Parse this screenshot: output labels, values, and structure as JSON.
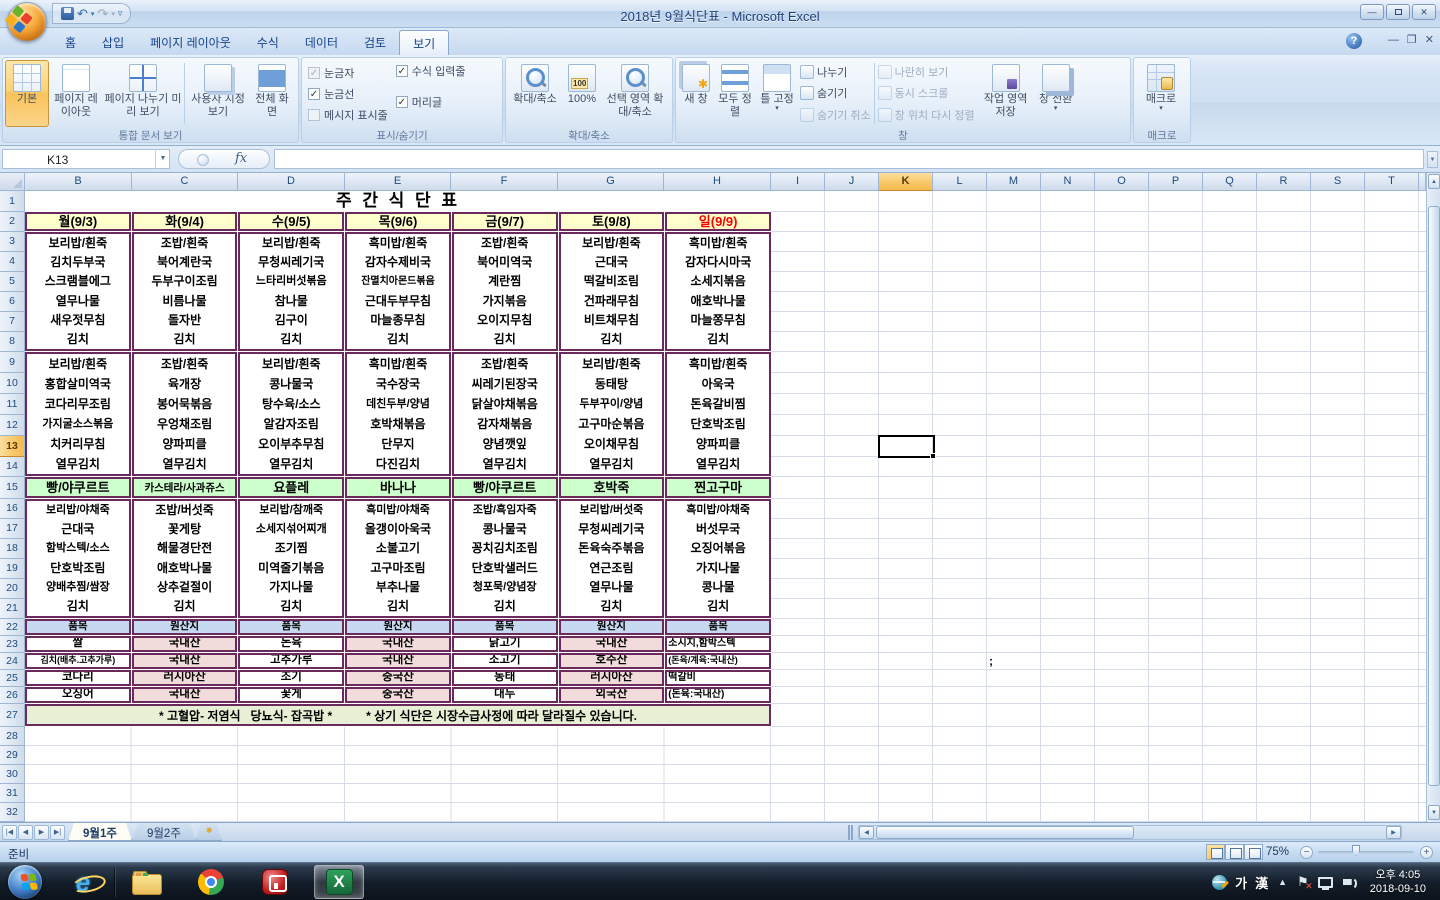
{
  "window": {
    "title": "2018년 9월식단표 - Microsoft Excel",
    "controls": {
      "minimize": "—",
      "restore": "❐",
      "close": "✕",
      "help": "?"
    }
  },
  "ribbon": {
    "active_tab": "보기",
    "tabs": [
      "홈",
      "삽입",
      "페이지 레이아웃",
      "수식",
      "데이터",
      "검토",
      "보기"
    ],
    "groups": [
      {
        "label": "통합 문서 보기",
        "buttons": [
          {
            "label": "기본",
            "icon": "normal-view",
            "active": true
          },
          {
            "label": "페이지 레이아웃",
            "icon": "page-layout"
          },
          {
            "label": "페이지 나누기 미리 보기",
            "icon": "page-break-preview"
          },
          {
            "label": "사용자 지정 보기",
            "icon": "custom-views"
          },
          {
            "label": "전체 화면",
            "icon": "full-screen"
          }
        ]
      },
      {
        "label": "표시/숨기기",
        "checkboxes": [
          {
            "label": "눈금자",
            "checked": true,
            "enabled": false
          },
          {
            "label": "눈금선",
            "checked": true,
            "enabled": true
          },
          {
            "label": "메시지 표시줄",
            "checked": false,
            "enabled": false
          },
          {
            "label": "수식 입력줄",
            "checked": true,
            "enabled": true
          },
          {
            "label": "머리글",
            "checked": true,
            "enabled": true
          }
        ]
      },
      {
        "label": "확대/축소",
        "buttons": [
          {
            "label": "확대/축소",
            "icon": "zoom"
          },
          {
            "label": "100%",
            "icon": "zoom-100"
          },
          {
            "label": "선택 영역 확대/축소",
            "icon": "zoom-selection"
          }
        ]
      },
      {
        "label": "창",
        "buttons": [
          {
            "label": "새 창",
            "icon": "new-window"
          },
          {
            "label": "모두 정렬",
            "icon": "arrange-all"
          },
          {
            "label": "틀 고정",
            "icon": "freeze-panes",
            "dropdown": true
          },
          {
            "label": "나누기",
            "icon": "split",
            "small": true,
            "enabled": true
          },
          {
            "label": "숨기기",
            "icon": "hide",
            "small": true,
            "enabled": true
          },
          {
            "label": "숨기기 취소",
            "icon": "unhide",
            "small": true,
            "enabled": false
          },
          {
            "label": "나란히 보기",
            "icon": "view-side-by-side",
            "small": true,
            "enabled": false
          },
          {
            "label": "동시 스크롤",
            "icon": "synchronous-scrolling",
            "small": true,
            "enabled": false
          },
          {
            "label": "창 위치 다시 정렬",
            "icon": "reset-window-position",
            "small": true,
            "enabled": false
          },
          {
            "label": "작업 영역 저장",
            "icon": "save-workspace"
          },
          {
            "label": "창 전환",
            "icon": "switch-windows",
            "dropdown": true
          }
        ]
      },
      {
        "label": "매크로",
        "buttons": [
          {
            "label": "매크로",
            "icon": "macros",
            "dropdown": true
          }
        ]
      }
    ]
  },
  "formula_bar": {
    "name_box": "K13",
    "fx_label": "fx",
    "formula": ""
  },
  "sheet": {
    "columns": [
      "B",
      "C",
      "D",
      "E",
      "F",
      "G",
      "H",
      "I",
      "J",
      "K",
      "L",
      "M",
      "N",
      "O",
      "P",
      "Q",
      "R",
      "S",
      "T"
    ],
    "rows_visible": 32,
    "selection": {
      "cell": "K13",
      "column": "K",
      "row": 13
    },
    "stray_text": ";",
    "menu": {
      "title": "주 간 식 단 표",
      "colors": {
        "border": "#6b2a5e",
        "day_bg": "#ffffcc",
        "snack_bg": "#ccffcc",
        "origin_header_bg": "#c7d9f0",
        "origin_value_bg": "#f2dcdb",
        "note_bg": "#e7efd4",
        "sunday_red": "#ff0000"
      },
      "days": [
        {
          "label": "월(9/3)",
          "color": "#000000"
        },
        {
          "label": "화(9/4)",
          "color": "#000000"
        },
        {
          "label": "수(9/5)",
          "color": "#000000"
        },
        {
          "label": "목(9/6)",
          "color": "#000000"
        },
        {
          "label": "금(9/7)",
          "color": "#000000"
        },
        {
          "label": "토(9/8)",
          "color": "#000000"
        },
        {
          "label": "일(9/9)",
          "color": "#ff0000"
        }
      ],
      "breakfast": [
        [
          "보리밥/흰죽",
          "김치두부국",
          "스크램블에그",
          "열무나물",
          "새우젓무침",
          "김치"
        ],
        [
          "조밥/흰죽",
          "북어계란국",
          "두부구이조림",
          "비름나물",
          "돌자반",
          "김치"
        ],
        [
          "보리밥/흰죽",
          "무청씨레기국",
          "느타리버섯볶음",
          "참나물",
          "김구이",
          "김치"
        ],
        [
          "흑미밥/흰죽",
          "감자수제비국",
          "잔멸치아몬드볶음",
          "근대두부무침",
          "마늘종무침",
          "김치"
        ],
        [
          "조밥/흰죽",
          "북어미역국",
          "계란찜",
          "가지볶음",
          "오이지무침",
          "김치"
        ],
        [
          "보리밥/흰죽",
          "근대국",
          "떡갈비조림",
          "건파래무침",
          "비트채무침",
          "김치"
        ],
        [
          "흑미밥/흰죽",
          "감자다시마국",
          "소세지볶음",
          "애호박나물",
          "마늘쫑무침",
          "김치"
        ]
      ],
      "lunch": [
        [
          "보리밥/흰죽",
          "홍합살미역국",
          "코다리무조림",
          "가지굴소스볶음",
          "치커리무침",
          "열무김치"
        ],
        [
          "조밥/흰죽",
          "육개장",
          "봉어묵볶음",
          "우엉채조림",
          "양파피클",
          "열무김치"
        ],
        [
          "보리밥/흰죽",
          "콩나물국",
          "탕수육/소스",
          "알감자조림",
          "오이부추무침",
          "열무김치"
        ],
        [
          "흑미밥/흰죽",
          "국수장국",
          "데친두부/양념",
          "호박채볶음",
          "단무지",
          "다진김치"
        ],
        [
          "조밥/흰죽",
          "씨레기된장국",
          "닭살야채볶음",
          "감자채볶음",
          "양념깻잎",
          "열무김치"
        ],
        [
          "보리밥/흰죽",
          "동태탕",
          "두부꾸이/양념",
          "고구마순볶음",
          "오이채무침",
          "열무김치"
        ],
        [
          "흑미밥/흰죽",
          "아욱국",
          "돈육갈비찜",
          "단호박조림",
          "양파피클",
          "열무김치"
        ]
      ],
      "snack": [
        "빵/야쿠르트",
        "카스테라/사과쥬스",
        "요플레",
        "바나나",
        "빵/야쿠르트",
        "호박죽",
        "찐고구마"
      ],
      "dinner": [
        [
          "보리밥/야채죽",
          "근대국",
          "함박스텍/소스",
          "단호박조림",
          "양배추찜/쌈장",
          "김치"
        ],
        [
          "조밥/버섯죽",
          "꽃게탕",
          "해물경단전",
          "애호박나물",
          "상추겉절이",
          "김치"
        ],
        [
          "보리밥/참깨죽",
          "소세지섞어찌개",
          "조기찜",
          "미역줄기볶음",
          "가지나물",
          "김치"
        ],
        [
          "흑미밥/야채죽",
          "올갱이아욱국",
          "소불고기",
          "고구마조림",
          "부추나물",
          "김치"
        ],
        [
          "조밥/흑임자죽",
          "콩나물국",
          "꽁치김치조림",
          "단호박샐러드",
          "청포묵/양념장",
          "김치"
        ],
        [
          "보리밥/버섯죽",
          "무청씨레기국",
          "돈육숙주볶음",
          "연근조림",
          "열무나물",
          "김치"
        ],
        [
          "흑미밥/야채죽",
          "버섯무국",
          "오징어볶음",
          "가지나물",
          "콩나물",
          "김치"
        ]
      ],
      "origin": {
        "headers": [
          "품목",
          "원산지",
          "품목",
          "원산지",
          "품목",
          "원산지",
          "품목"
        ],
        "rows": [
          [
            "쌀",
            "국내산",
            "돈육",
            "국내산",
            "닭고기",
            "국내산",
            "소시지,함박스텍"
          ],
          [
            "김치(배추.고추가루)",
            "국내산",
            "고추가루",
            "국내산",
            "소고기",
            "호주산",
            "(돈육/계육:국내산)"
          ],
          [
            "코다리",
            "러시아산",
            "조기",
            "중국산",
            "동태",
            "러시아산",
            "떡갈비"
          ],
          [
            "오징어",
            "국내산",
            "꽃게",
            "중국산",
            "대두",
            "외국산",
            "(돈육:국내산)"
          ]
        ]
      },
      "notes": [
        "* 고혈압- 저염식   당뇨식- 잡곡밥 *",
        "* 상기 식단은 시장수급사정에 따라 달라질수 있습니다."
      ]
    }
  },
  "sheet_tabs": {
    "tabs": [
      {
        "label": "9월1주",
        "active": true
      },
      {
        "label": "9월2주",
        "active": false
      }
    ]
  },
  "status_bar": {
    "message": "준비",
    "zoom": "75%"
  },
  "taskbar": {
    "apps": [
      "start",
      "internet-explorer",
      "file-explorer",
      "chrome",
      "red-utility",
      "excel"
    ],
    "active_app": "excel",
    "tray": {
      "ime_korean": "가",
      "ime_hanja": "漢",
      "time": "오후 4:05",
      "date": "2018-09-10"
    }
  }
}
